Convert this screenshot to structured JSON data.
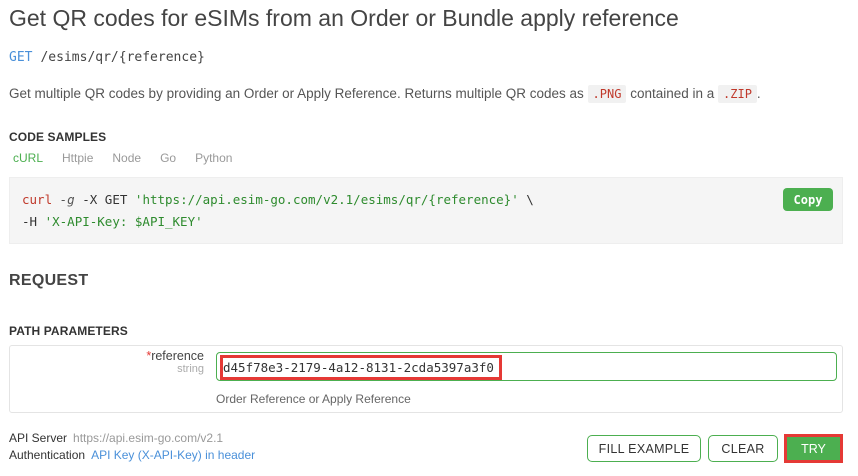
{
  "header": {
    "title": "Get QR codes for eSIMs from an Order or Bundle apply reference",
    "method": "GET",
    "path": "/esims/qr/{reference}"
  },
  "description": {
    "text_before": "Get multiple QR codes by providing an Order or Apply Reference. Returns multiple QR codes as ",
    "code1": ".PNG",
    "text_middle": " contained in a ",
    "code2": ".ZIP",
    "text_after": "."
  },
  "code_samples": {
    "label": "CODE SAMPLES",
    "tabs": [
      "cURL",
      "Httpie",
      "Node",
      "Go",
      "Python"
    ],
    "active_tab": "cURL",
    "line1": {
      "cmd": "curl",
      "flag": "-g",
      "opts": " -X GET ",
      "url": "'https://api.esim-go.com/v2.1/esims/qr/{reference}'",
      "cont": " \\"
    },
    "line2": {
      "flag": "-H",
      "header": "'X-API-Key: $API_KEY'"
    },
    "copy_label": "Copy"
  },
  "request": {
    "title": "REQUEST",
    "path_params_label": "PATH PARAMETERS",
    "param": {
      "required_mark": "*",
      "name": "reference",
      "type": "string",
      "value": "d45f78e3-2179-4a12-8131-2cda5397a3f0",
      "help": "Order Reference or Apply Reference"
    }
  },
  "footer": {
    "api_server_label": "API Server",
    "api_server_value": "https://api.esim-go.com/v2.1",
    "auth_label": "Authentication",
    "auth_value": "API Key (X-API-Key) in header",
    "fill_example": "FILL EXAMPLE",
    "clear": "CLEAR",
    "try": "TRY"
  },
  "colors": {
    "accent_green": "#4caf50",
    "link_blue": "#4a90d9",
    "highlight_red": "#e53935"
  }
}
